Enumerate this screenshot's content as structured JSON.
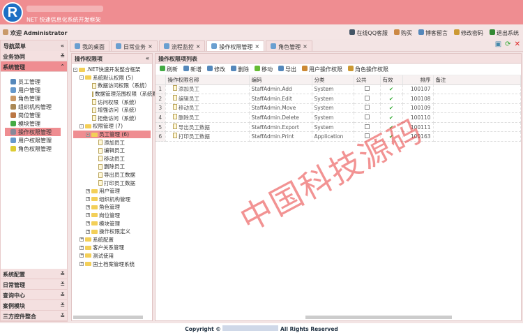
{
  "header": {
    "logo_letter": "R",
    "subtitle": "NET 快速信息化系统开发框架"
  },
  "topbar": {
    "welcome": "欢迎 Administrator",
    "links": [
      "在线QQ客服",
      "购买",
      "博客留言",
      "修改密码",
      "退出系统"
    ]
  },
  "nav": {
    "title": "导航菜单",
    "groups_top": [
      "业务协同",
      "系统管理"
    ],
    "items": [
      "员工管理",
      "用户管理",
      "角色管理",
      "组织机构管理",
      "岗位管理",
      "模块管理",
      "操作权限管理",
      "用户权限管理",
      "角色权限管理"
    ],
    "selected_item": "操作权限管理",
    "groups_bottom": [
      "系统配置",
      "日常管理",
      "查询中心",
      "案例模块",
      "三方控件整合"
    ]
  },
  "tabs": [
    {
      "label": "我的桌面",
      "closable": false
    },
    {
      "label": "日常业务",
      "closable": true
    },
    {
      "label": "流程监控",
      "closable": true
    },
    {
      "label": "操作权限管理",
      "closable": true,
      "active": true
    },
    {
      "label": "角色管理",
      "closable": true
    }
  ],
  "tree": {
    "title": "操作权限项",
    "nodes": [
      {
        "label": ".NET快速开发整合框架",
        "level": 0,
        "type": "folder",
        "exp": "-"
      },
      {
        "label": "系统默认权限 (5)",
        "level": 1,
        "type": "folder",
        "exp": "-"
      },
      {
        "label": "数据访问权限（系统）",
        "level": 2,
        "type": "doc"
      },
      {
        "label": "数据管理范围权限（系统默认）",
        "level": 2,
        "type": "doc"
      },
      {
        "label": "访问权限（系统）",
        "level": 2,
        "type": "doc"
      },
      {
        "label": "增强访问（系统）",
        "level": 2,
        "type": "doc"
      },
      {
        "label": "拒绝访问（系统）",
        "level": 2,
        "type": "doc"
      },
      {
        "label": "权限管理 (7)",
        "level": 1,
        "type": "folder",
        "exp": "-"
      },
      {
        "label": "员工管理 (6)",
        "level": 2,
        "type": "folder",
        "exp": "-",
        "selected": true
      },
      {
        "label": "添加员工",
        "level": 3,
        "type": "doc"
      },
      {
        "label": "编辑员工",
        "level": 3,
        "type": "doc"
      },
      {
        "label": "移动员工",
        "level": 3,
        "type": "doc"
      },
      {
        "label": "删除员工",
        "level": 3,
        "type": "doc"
      },
      {
        "label": "导出员工数据",
        "level": 3,
        "type": "doc"
      },
      {
        "label": "打印员工数据",
        "level": 3,
        "type": "doc"
      },
      {
        "label": "用户管理",
        "level": 2,
        "type": "folder",
        "exp": "+"
      },
      {
        "label": "组织机构管理",
        "level": 2,
        "type": "folder",
        "exp": "+"
      },
      {
        "label": "角色管理",
        "level": 2,
        "type": "folder",
        "exp": "+"
      },
      {
        "label": "岗位管理",
        "level": 2,
        "type": "folder",
        "exp": "+"
      },
      {
        "label": "模块管理",
        "level": 2,
        "type": "folder",
        "exp": "+"
      },
      {
        "label": "操作权限定义",
        "level": 2,
        "type": "folder",
        "exp": "+"
      },
      {
        "label": "系统配置",
        "level": 1,
        "type": "folder",
        "exp": "+"
      },
      {
        "label": "客户关系管理",
        "level": 1,
        "type": "folder",
        "exp": "+"
      },
      {
        "label": "测试使用",
        "level": 1,
        "type": "folder",
        "exp": "+"
      },
      {
        "label": "国土档案管理系统",
        "level": 1,
        "type": "folder",
        "exp": "+"
      }
    ]
  },
  "grid": {
    "title": "操作权限项列表",
    "toolbar": [
      "刷新",
      "新增",
      "修改",
      "删除",
      "移动",
      "导出",
      "用户操作权限",
      "角色操作权限"
    ],
    "columns": [
      "操作权限名称",
      "编码",
      "分类",
      "公共",
      "有效",
      "排序",
      "备注"
    ],
    "rows": [
      [
        "1",
        "添加员工",
        "StaffAdmin.Add",
        "System",
        "",
        "✔",
        "100107",
        ""
      ],
      [
        "2",
        "编辑员工",
        "StaffAdmin.Edit",
        "System",
        "",
        "✔",
        "100108",
        ""
      ],
      [
        "3",
        "移动员工",
        "StaffAdmin.Move",
        "System",
        "",
        "✔",
        "100109",
        ""
      ],
      [
        "4",
        "删除员工",
        "StaffAdmin.Delete",
        "System",
        "",
        "✔",
        "100110",
        ""
      ],
      [
        "5",
        "导出员工数据",
        "StaffAdmin.Export",
        "System",
        "",
        "✔",
        "100111",
        ""
      ],
      [
        "6",
        "打印员工数据",
        "StaffAdmin.Print",
        "Application",
        "",
        "✔",
        "100163",
        ""
      ]
    ]
  },
  "footer": {
    "left": "Copyright ©",
    "right": "All Rights Reserved"
  },
  "watermark": "中国科技源码"
}
